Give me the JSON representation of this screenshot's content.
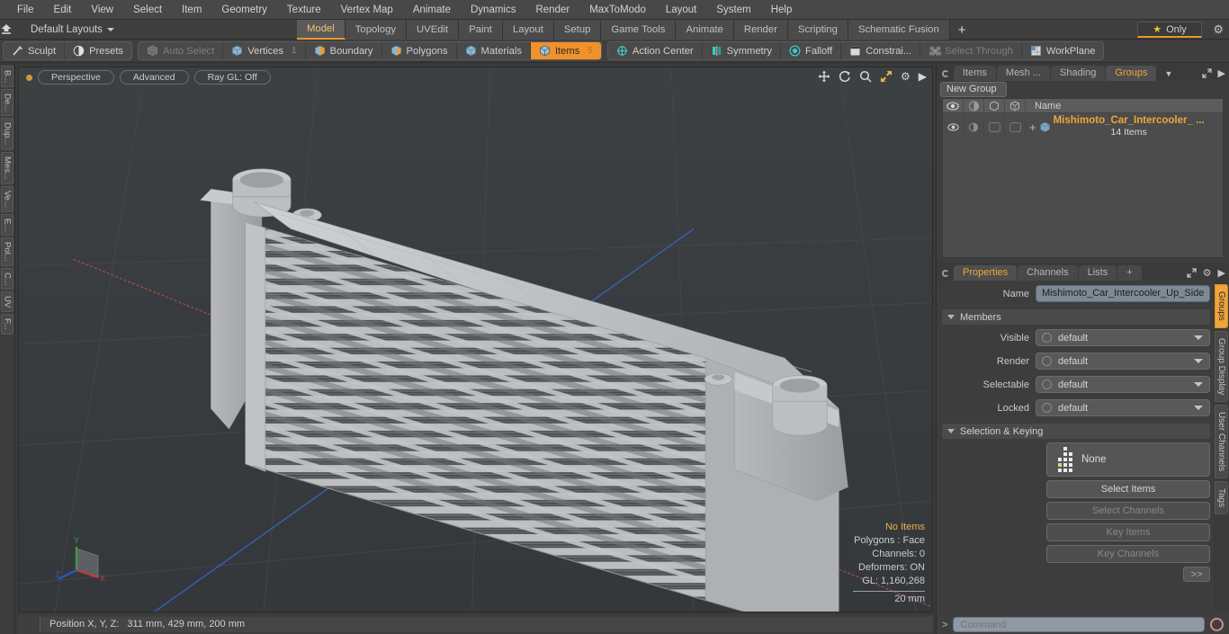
{
  "menubar": {
    "items": [
      "File",
      "Edit",
      "View",
      "Select",
      "Item",
      "Geometry",
      "Texture",
      "Vertex Map",
      "Animate",
      "Dynamics",
      "Render",
      "MaxToModo",
      "Layout",
      "System",
      "Help"
    ]
  },
  "layoutrow": {
    "home_icon": "home-up-icon",
    "layout_label": "Default Layouts",
    "tabs": [
      {
        "label": "Model",
        "active": true
      },
      {
        "label": "Topology",
        "active": false
      },
      {
        "label": "UVEdit",
        "active": false
      },
      {
        "label": "Paint",
        "active": false
      },
      {
        "label": "Layout",
        "active": false
      },
      {
        "label": "Setup",
        "active": false
      },
      {
        "label": "Game Tools",
        "active": false
      },
      {
        "label": "Animate",
        "active": false
      },
      {
        "label": "Render",
        "active": false
      },
      {
        "label": "Scripting",
        "active": false
      },
      {
        "label": "Schematic Fusion",
        "active": false
      }
    ],
    "add_tab_label": "+",
    "only_label": "Only",
    "only_star_icon": "star-icon",
    "gear_icon": "gear-icon"
  },
  "toolbar": {
    "group1": [
      {
        "label": "Sculpt",
        "icon": "sculpt-brush-icon",
        "state": "normal",
        "badge": ""
      },
      {
        "label": "Presets",
        "icon": "presets-sphere-icon",
        "state": "normal",
        "badge": ""
      }
    ],
    "group2": [
      {
        "label": "Auto Select",
        "icon": "cube-gray-icon",
        "state": "dim",
        "badge": ""
      },
      {
        "label": "Vertices",
        "icon": "cube-blue-icon",
        "state": "normal",
        "badge": "1"
      },
      {
        "label": "Boundary",
        "icon": "cube-edge-icon",
        "state": "normal",
        "badge": ""
      },
      {
        "label": "Polygons",
        "icon": "cube-poly-icon",
        "state": "normal",
        "badge": ""
      },
      {
        "label": "Materials",
        "icon": "cube-blue-icon",
        "state": "normal",
        "badge": ""
      },
      {
        "label": "Items",
        "icon": "cube-orange-icon",
        "state": "on",
        "badge": "5"
      }
    ],
    "group3": [
      {
        "label": "Action Center",
        "icon": "action-center-icon",
        "state": "normal",
        "badge": ""
      },
      {
        "label": "Symmetry",
        "icon": "symmetry-icon",
        "state": "normal",
        "badge": ""
      },
      {
        "label": "Falloff",
        "icon": "falloff-icon",
        "state": "normal",
        "badge": ""
      },
      {
        "label": "Constrai...",
        "icon": "constraint-icon",
        "state": "normal",
        "badge": ""
      },
      {
        "label": "Select Through",
        "icon": "select-through-icon",
        "state": "dim",
        "badge": ""
      },
      {
        "label": "WorkPlane",
        "icon": "workplane-icon",
        "state": "normal",
        "badge": ""
      }
    ]
  },
  "left_tabs": [
    "B...",
    "De...",
    "Dup...",
    "Mes...",
    "Ve...",
    "E...",
    "Pol...",
    "C...",
    "UV",
    "F..."
  ],
  "viewport": {
    "view_mode": "Perspective",
    "shading_mode": "Advanced",
    "raygl": "Ray GL: Off",
    "icons": [
      "move-icon",
      "rotate-icon",
      "zoom-icon",
      "fit-icon",
      "gear-icon",
      "play-arrow-icon"
    ],
    "stats": {
      "selection": "No Items",
      "polygons": "Polygons : Face",
      "channels": "Channels: 0",
      "deformers": "Deformers: ON",
      "gl": "GL: 1,160,268"
    },
    "scale_label": "20 mm",
    "axis_labels": {
      "x": "X",
      "y": "Y",
      "z": "Z"
    },
    "colors": {
      "background": "#373b3e",
      "axis_x": "#b4504a",
      "axis_y": "#5a9a4a",
      "axis_z": "#3a5fc0",
      "model": "#b9bbbd"
    }
  },
  "statusbar": {
    "position_label": "Position X, Y, Z:",
    "position_value": "311 mm, 429 mm, 200 mm"
  },
  "rightpanel": {
    "top_tabs": [
      {
        "label": "Items",
        "active": false
      },
      {
        "label": "Mesh ...",
        "active": false
      },
      {
        "label": "Shading",
        "active": false
      },
      {
        "label": "Groups",
        "active": true
      }
    ],
    "top_tab_caret": "chevron-down-icon",
    "expand_icon": "expand-icon",
    "arrow_icon": "right-arrow-icon",
    "new_group_label": "New Group",
    "tree": {
      "column_icons": [
        "eye-icon",
        "render-icon",
        "cube-outline-icon",
        "cube-outline-icon"
      ],
      "name_header": "Name",
      "rows": [
        {
          "expander": "+",
          "item_icon": "group-cube-icon",
          "name": "Mishimoto_Car_Intercooler_ ...",
          "subtitle": "14 Items"
        }
      ]
    },
    "prop_tabs": [
      {
        "label": "Properties",
        "active": true
      },
      {
        "label": "Channels",
        "active": false
      },
      {
        "label": "Lists",
        "active": false
      },
      {
        "label": "+",
        "active": false
      }
    ],
    "prop_tab_icons": [
      "expand-icon",
      "gear-icon",
      "right-arrow-icon"
    ],
    "name_label": "Name",
    "name_value": "Mishimoto_Car_Intercooler_Up_Side",
    "members_section": "Members",
    "members": [
      {
        "label": "Visible",
        "value": "default"
      },
      {
        "label": "Render",
        "value": "default"
      },
      {
        "label": "Selectable",
        "value": "default"
      },
      {
        "label": "Locked",
        "value": "default"
      }
    ],
    "selection_section": "Selection & Keying",
    "selection_none": "None",
    "buttons": [
      {
        "label": "Select Items",
        "enabled": true
      },
      {
        "label": "Select Channels",
        "enabled": false
      },
      {
        "label": "Key Items",
        "enabled": false
      },
      {
        "label": "Key Channels",
        "enabled": false
      }
    ],
    "more_button": ">>",
    "side_tabs": [
      {
        "label": "Groups",
        "active": true
      },
      {
        "label": "Group Display",
        "active": false
      },
      {
        "label": "User Channels",
        "active": false
      },
      {
        "label": "Tags",
        "active": false
      }
    ]
  },
  "command": {
    "prompt": ">",
    "placeholder": "Command",
    "record_icon": "record-circle-icon"
  },
  "colors": {
    "accent": "#f0a53a",
    "toolbar_active": "#f0912b",
    "panel_bg": "#3d3d3d",
    "viewport_bg": "#373b3e"
  }
}
